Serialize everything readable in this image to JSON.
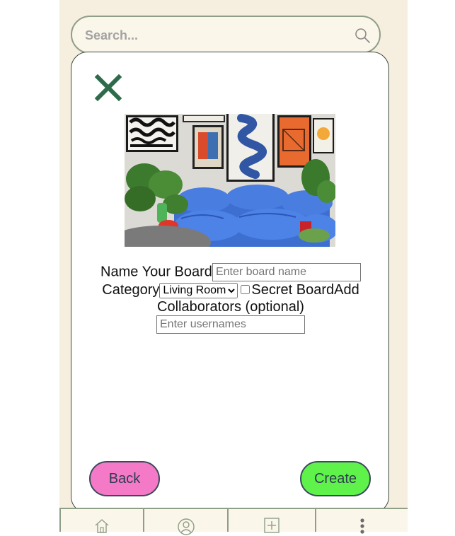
{
  "search": {
    "placeholder": "Search..."
  },
  "modal": {
    "close_icon": "close-x-icon",
    "image_alt": "living room with blue sofa and framed posters",
    "form": {
      "board_name_label": "Name Your Board",
      "board_name_placeholder": "Enter board name",
      "category_label": "Category",
      "category_selected": "Living Room",
      "secret_board_label": "Secret Board",
      "collaborators_label": "Add Collaborators (optional)",
      "collaborators_placeholder": "Enter usernames"
    },
    "buttons": {
      "back": "Back",
      "create": "Create"
    }
  },
  "bottom_nav": {
    "items": [
      {
        "icon": "home-icon"
      },
      {
        "icon": "profile-icon"
      },
      {
        "icon": "add-icon"
      },
      {
        "icon": "more-icon"
      }
    ]
  },
  "colors": {
    "app_background": "#f6efe0",
    "close_icon": "#2e6b4b",
    "back_button": "#f47ac8",
    "create_button": "#5ff24a",
    "border": "#8f9e86"
  }
}
